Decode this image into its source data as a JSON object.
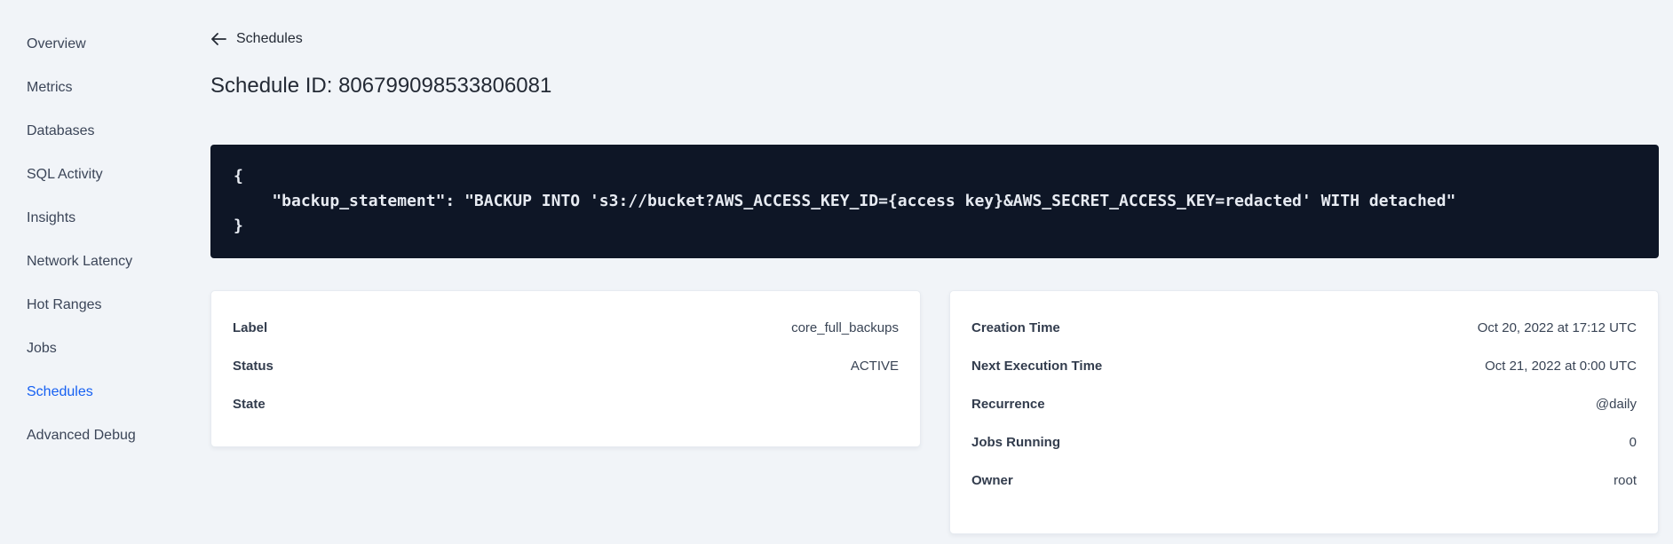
{
  "sidebar": {
    "items": [
      {
        "label": "Overview",
        "active": false
      },
      {
        "label": "Metrics",
        "active": false
      },
      {
        "label": "Databases",
        "active": false
      },
      {
        "label": "SQL Activity",
        "active": false
      },
      {
        "label": "Insights",
        "active": false
      },
      {
        "label": "Network Latency",
        "active": false
      },
      {
        "label": "Hot Ranges",
        "active": false
      },
      {
        "label": "Jobs",
        "active": false
      },
      {
        "label": "Schedules",
        "active": true
      },
      {
        "label": "Advanced Debug",
        "active": false
      }
    ]
  },
  "header": {
    "back_icon": "left-arrow-icon",
    "back_label": "Schedules",
    "title": "Schedule ID: 806799098533806081"
  },
  "schedule_definition": {
    "lines": [
      "{",
      "    \"backup_statement\": \"BACKUP INTO 's3://bucket?AWS_ACCESS_KEY_ID={access key}&AWS_SECRET_ACCESS_KEY=redacted' WITH detached\"",
      "}"
    ]
  },
  "status_card": {
    "rows": [
      {
        "label": "Label",
        "value": "core_full_backups"
      },
      {
        "label": "Status",
        "value": "ACTIVE"
      },
      {
        "label": "State",
        "value": ""
      }
    ]
  },
  "info_card": {
    "rows": [
      {
        "label": "Creation Time",
        "value": "Oct 20, 2022 at 17:12 UTC"
      },
      {
        "label": "Next Execution Time",
        "value": "Oct 21, 2022 at 0:00 UTC"
      },
      {
        "label": "Recurrence",
        "value": "@daily"
      },
      {
        "label": "Jobs Running",
        "value": "0"
      },
      {
        "label": "Owner",
        "value": "root"
      }
    ]
  },
  "colors": {
    "page_background": "#f1f4f8",
    "active_nav_blue": "#1660f2",
    "text_primary": "#242a35",
    "text_secondary": "#394455",
    "code_background": "#0e1626",
    "code_text": "#e7ebf2",
    "card_background": "#ffffff",
    "card_border": "#e7ebf1"
  }
}
